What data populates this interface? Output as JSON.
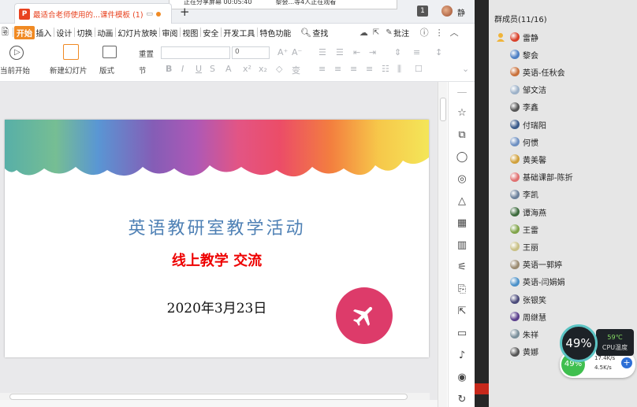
{
  "titlebar": {
    "tab_title": "最适合老师使用的...课件模板 (1)",
    "add_tab": "+",
    "share_status": "正在分享屏幕   00:05:40",
    "share_viewers": "黎会...等4人正在观看",
    "badge": "1",
    "user_name": "静"
  },
  "menubar": {
    "items": [
      "开始",
      "插入",
      "设计",
      "切换",
      "动画",
      "幻灯片放映",
      "审阅",
      "视图",
      "安全",
      "开发工具",
      "特色功能"
    ],
    "search_label": "查找",
    "annotate_label": "批注"
  },
  "ribbon": {
    "from_current": "当前开始",
    "new_slide": "新建幻灯片",
    "layout": "版式",
    "section": "节",
    "reset": "重置",
    "font_size": "0",
    "font_name": ""
  },
  "slide": {
    "title": "英语教研室教学活动",
    "subtitle": "线上教学 交流",
    "date": "2020年3月23日",
    "colors": {
      "title": "#4f81b5",
      "subtitle": "#ee0000",
      "circle": "#dd3b6a"
    }
  },
  "members": {
    "header": "群成员(11/16)",
    "list": [
      {
        "name": "雷静",
        "color": "#d8402a"
      },
      {
        "name": "黎会",
        "color": "#4d7fc4"
      },
      {
        "name": "英语-任秋会",
        "color": "#c9703a"
      },
      {
        "name": "邹文洁",
        "color": "#9cb1c8"
      },
      {
        "name": "李鑫",
        "color": "#555555"
      },
      {
        "name": "付瑞阳",
        "color": "#3a5a8a"
      },
      {
        "name": "何惯",
        "color": "#6d8fc1"
      },
      {
        "name": "黄美馨",
        "color": "#d0a03a"
      },
      {
        "name": "基础课部-陈折",
        "color": "#e07070"
      },
      {
        "name": "李凯",
        "color": "#6a7f9a"
      },
      {
        "name": "谭海燕",
        "color": "#3d6b3d"
      },
      {
        "name": "王雷",
        "color": "#7fa348"
      },
      {
        "name": "王丽",
        "color": "#c9c085"
      },
      {
        "name": "英语一郭婷",
        "color": "#9a8a70"
      },
      {
        "name": "英语-闫娟娟",
        "color": "#4a90c8"
      },
      {
        "name": "张银笑",
        "color": "#4a4a7a"
      },
      {
        "name": "周继慧",
        "color": "#5b3f8c"
      },
      {
        "name": "朱祥",
        "color": "#7a8f9a"
      },
      {
        "name": "黄娜",
        "color": "#555555"
      }
    ]
  },
  "cpu_widget": {
    "cpu_percent": "49%",
    "temp": "59℃",
    "temp_label": "CPU温度",
    "mem_percent": "49%",
    "upload": "17.4K/s",
    "download": "4.5K/s"
  }
}
